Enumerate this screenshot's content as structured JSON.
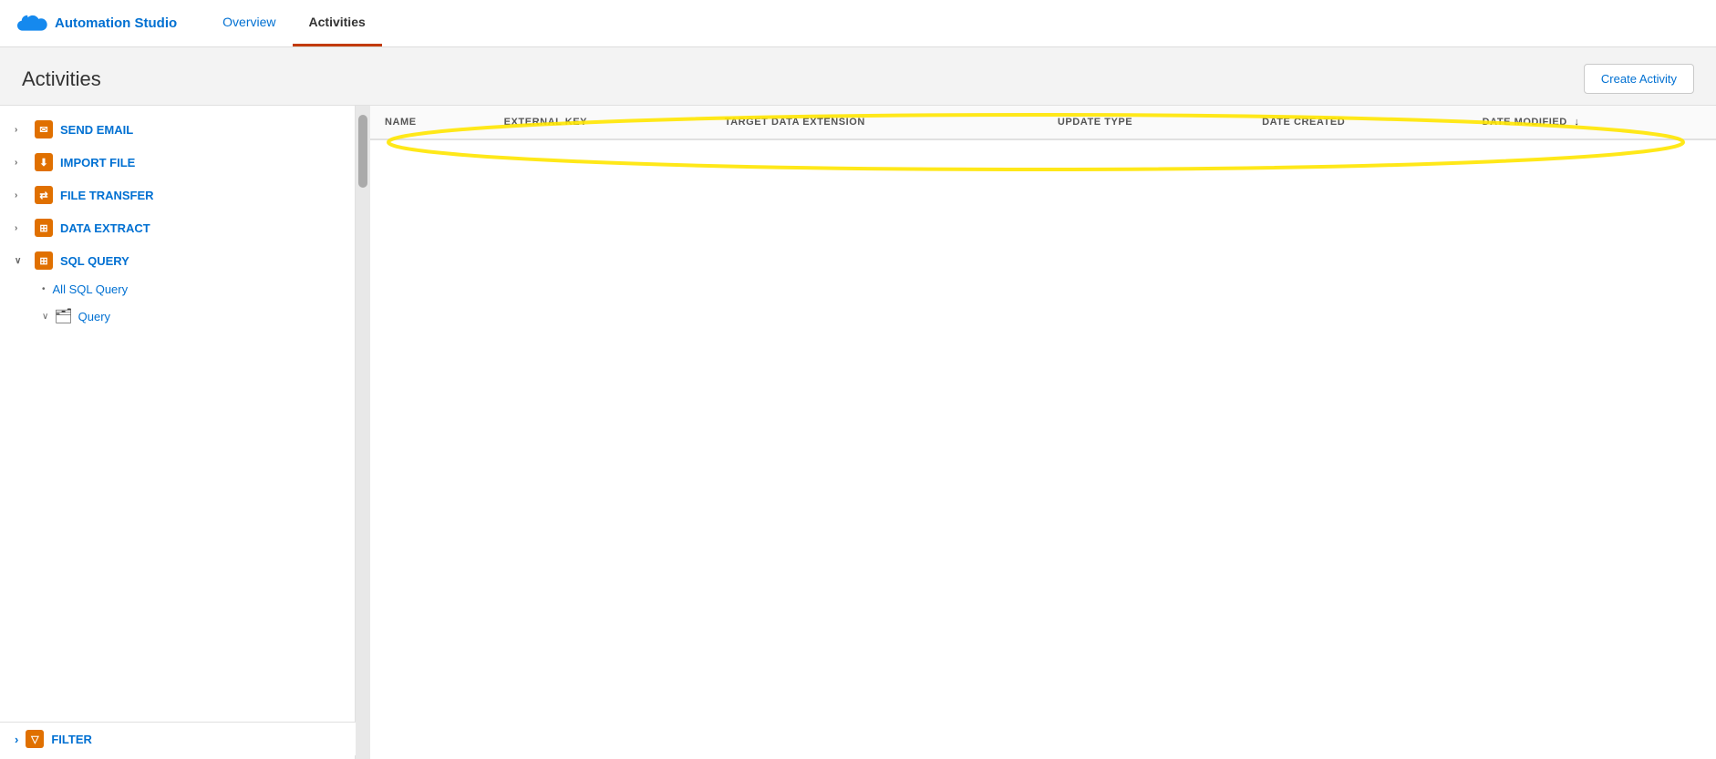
{
  "app": {
    "name": "Automation Studio",
    "logo_alt": "Salesforce"
  },
  "nav": {
    "tabs": [
      {
        "id": "overview",
        "label": "Overview",
        "active": false
      },
      {
        "id": "activities",
        "label": "Activities",
        "active": true
      }
    ]
  },
  "page": {
    "title": "Activities",
    "create_button_label": "Create Activity"
  },
  "sidebar": {
    "items": [
      {
        "id": "send-email",
        "label": "SEND EMAIL",
        "chevron": "›",
        "expanded": false
      },
      {
        "id": "import-file",
        "label": "IMPORT FILE",
        "chevron": "›",
        "expanded": false
      },
      {
        "id": "file-transfer",
        "label": "FILE TRANSFER",
        "chevron": "›",
        "expanded": false
      },
      {
        "id": "data-extract",
        "label": "DATA EXTRACT",
        "chevron": "›",
        "expanded": false
      },
      {
        "id": "sql-query",
        "label": "SQL QUERY",
        "chevron": "∨",
        "expanded": true
      }
    ],
    "sql_query_sub": [
      {
        "id": "all-sql-query",
        "label": "All SQL Query",
        "type": "bullet"
      },
      {
        "id": "query-folder",
        "label": "Query",
        "type": "folder",
        "chevron": "∨"
      }
    ],
    "filter": {
      "label": "FILTER",
      "chevron": "›"
    }
  },
  "table": {
    "columns": [
      {
        "id": "name",
        "label": "NAME"
      },
      {
        "id": "external-key",
        "label": "EXTERNAL KEY"
      },
      {
        "id": "target-data-extension",
        "label": "TARGET DATA EXTENSION"
      },
      {
        "id": "update-type",
        "label": "UPDATE TYPE"
      },
      {
        "id": "date-created",
        "label": "DATE CREATED"
      },
      {
        "id": "date-modified",
        "label": "DATE MODIFIED",
        "sorted": true,
        "sort_dir": "↓"
      }
    ],
    "rows": []
  },
  "colors": {
    "active_tab_border": "#c23b00",
    "link_color": "#0070d2",
    "icon_orange": "#e07000",
    "annotation_yellow": "#ffe600"
  }
}
